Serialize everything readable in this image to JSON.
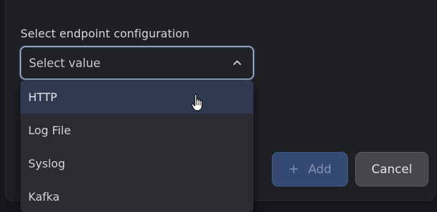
{
  "form": {
    "label": "Select endpoint configuration",
    "select": {
      "placeholder": "Select value",
      "expanded": true,
      "chevron_icon": "chevron-up-icon"
    }
  },
  "dropdown": {
    "options": [
      {
        "label": "HTTP",
        "highlighted": true
      },
      {
        "label": "Log File",
        "highlighted": false
      },
      {
        "label": "Syslog",
        "highlighted": false
      },
      {
        "label": "Kafka",
        "highlighted": false
      }
    ]
  },
  "actions": {
    "add_label": "Add",
    "add_icon": "plus-icon",
    "add_disabled": true,
    "cancel_label": "Cancel"
  },
  "colors": {
    "background": "#1f2024",
    "select_border": "#8ea2c4",
    "menu_bg": "#2a2c31",
    "menu_highlight": "#2f3950",
    "add_button": "#344a73",
    "cancel_button": "#45474c"
  },
  "pointer": {
    "icon": "hand-pointer-icon"
  }
}
